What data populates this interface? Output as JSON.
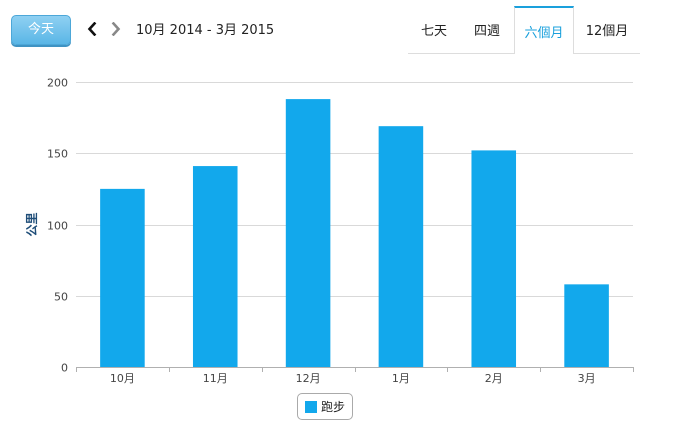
{
  "toolbar": {
    "today_label": "今天",
    "prev_icon": "chevron-left-icon",
    "next_icon": "chevron-right-icon",
    "date_range": "10月 2014 - 3月 2015",
    "tabs": [
      {
        "label": "七天",
        "active": false
      },
      {
        "label": "四週",
        "active": false
      },
      {
        "label": "六個月",
        "active": true
      },
      {
        "label": "12個月",
        "active": false
      }
    ]
  },
  "colors": {
    "bar": "#12a8ec",
    "accent": "#1aa0dc",
    "grid": "#d9d9d9",
    "axis_label": "#1f4e79"
  },
  "chart_data": {
    "type": "bar",
    "categories": [
      "10月",
      "11月",
      "12月",
      "1月",
      "2月",
      "3月"
    ],
    "series": [
      {
        "name": "跑步",
        "values": [
          125,
          141,
          188,
          169,
          152,
          58
        ]
      }
    ],
    "xlabel": "",
    "ylabel": "公里",
    "ylim": [
      0,
      200
    ],
    "yticks": [
      0,
      50,
      100,
      150,
      200
    ],
    "grid": true,
    "legend": "bottom-center"
  }
}
